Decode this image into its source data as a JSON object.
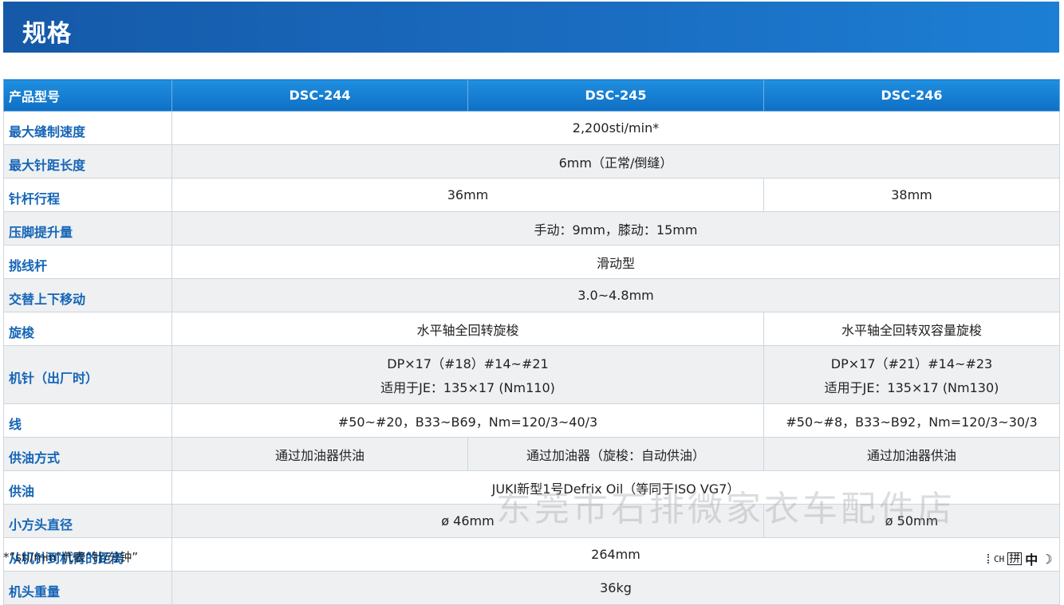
{
  "header": {
    "title": "规格"
  },
  "table": {
    "columns": [
      "产品型号",
      "DSC-244",
      "DSC-245",
      "DSC-246"
    ],
    "rows": [
      {
        "label": "最大缝制速度",
        "cells": [
          "2,200sti/min*"
        ]
      },
      {
        "label": "最大针距长度",
        "cells": [
          "6mm（正常/倒缝）"
        ]
      },
      {
        "label": "针杆行程",
        "cells": [
          "36mm",
          "38mm"
        ]
      },
      {
        "label": "压脚提升量",
        "cells": [
          "手动：9mm，膝动：15mm"
        ]
      },
      {
        "label": "挑线杆",
        "cells": [
          "滑动型"
        ]
      },
      {
        "label": "交替上下移动",
        "cells": [
          "3.0~4.8mm"
        ]
      },
      {
        "label": "旋梭",
        "cells": [
          "水平轴全回转旋梭",
          "水平轴全回转双容量旋梭"
        ]
      },
      {
        "label": "机针（出厂时）",
        "cells": [
          {
            "line1": "DP×17（#18）#14~#21",
            "line2": "适用于JE：135×17 (Nm110)"
          },
          {
            "line1": "DP×17（#21）#14~#23",
            "line2": "适用于JE：135×17 (Nm130)"
          }
        ]
      },
      {
        "label": "线",
        "cells": [
          "#50~#20，B33~B69，Nm=120/3~40/3",
          "#50~#8，B33~B92，Nm=120/3~30/3"
        ]
      },
      {
        "label": "供油方式",
        "cells": [
          "通过加油器供油",
          "通过加油器（旋梭：自动供油）",
          "通过加油器供油"
        ]
      },
      {
        "label": "供油",
        "cells": [
          "JUKI新型1号Defrix Oil（等同于ISO VG7）"
        ]
      },
      {
        "label": "小方头直径",
        "cells": [
          "ø 46mm",
          "ø 50mm"
        ]
      },
      {
        "label": "从机针到机臂的距离",
        "cells": [
          "264mm"
        ]
      },
      {
        "label": "机头重量",
        "cells": [
          "36kg"
        ]
      }
    ]
  },
  "footnote": "*“sti/min”代表“针/分钟”",
  "watermark": "东莞市石排微家衣车配件店",
  "ime": {
    "mode": "CH",
    "pinyin": "拼",
    "lang": "中",
    "moon": "☽"
  },
  "colors": {
    "banner": "#1a6cc0",
    "header_row": "#1379cf",
    "label_text": "#1565b6",
    "stripe": "#eef0f2"
  }
}
